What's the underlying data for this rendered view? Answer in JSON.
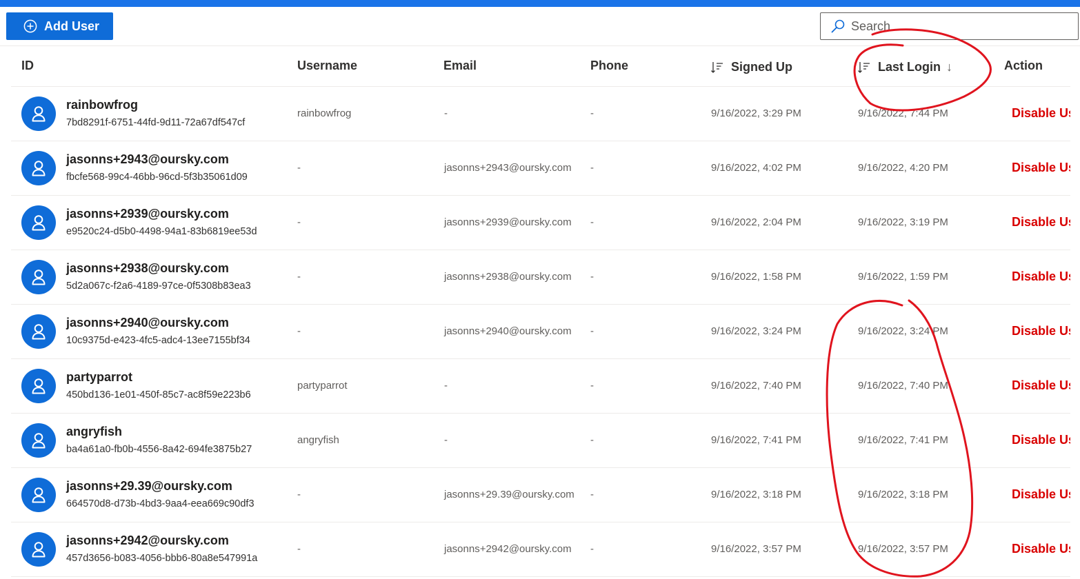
{
  "toolbar": {
    "add_user_label": "Add User",
    "search_placeholder": "Search"
  },
  "table": {
    "columns": {
      "id": "ID",
      "username": "Username",
      "email": "Email",
      "phone": "Phone",
      "signed_up": "Signed Up",
      "last_login": "Last Login",
      "last_login_sort_arrow": "↓",
      "action": "Action"
    },
    "rows": [
      {
        "name": "rainbowfrog",
        "id": "7bd8291f-6751-44fd-9d11-72a67df547cf",
        "username": "rainbowfrog",
        "email": "-",
        "phone": "-",
        "signed_up": "9/16/2022, 3:29 PM",
        "last_login": "9/16/2022, 7:44 PM",
        "action": "Disable User"
      },
      {
        "name": "jasonns+2943@oursky.com",
        "id": "fbcfe568-99c4-46bb-96cd-5f3b35061d09",
        "username": "-",
        "email": "jasonns+2943@oursky.com",
        "phone": "-",
        "signed_up": "9/16/2022, 4:02 PM",
        "last_login": "9/16/2022, 4:20 PM",
        "action": "Disable User"
      },
      {
        "name": "jasonns+2939@oursky.com",
        "id": "e9520c24-d5b0-4498-94a1-83b6819ee53d",
        "username": "-",
        "email": "jasonns+2939@oursky.com",
        "phone": "-",
        "signed_up": "9/16/2022, 2:04 PM",
        "last_login": "9/16/2022, 3:19 PM",
        "action": "Disable User"
      },
      {
        "name": "jasonns+2938@oursky.com",
        "id": "5d2a067c-f2a6-4189-97ce-0f5308b83ea3",
        "username": "-",
        "email": "jasonns+2938@oursky.com",
        "phone": "-",
        "signed_up": "9/16/2022, 1:58 PM",
        "last_login": "9/16/2022, 1:59 PM",
        "action": "Disable User"
      },
      {
        "name": "jasonns+2940@oursky.com",
        "id": "10c9375d-e423-4fc5-adc4-13ee7155bf34",
        "username": "-",
        "email": "jasonns+2940@oursky.com",
        "phone": "-",
        "signed_up": "9/16/2022, 3:24 PM",
        "last_login": "9/16/2022, 3:24 PM",
        "action": "Disable User"
      },
      {
        "name": "partyparrot",
        "id": "450bd136-1e01-450f-85c7-ac8f59e223b6",
        "username": "partyparrot",
        "email": "-",
        "phone": "-",
        "signed_up": "9/16/2022, 7:40 PM",
        "last_login": "9/16/2022, 7:40 PM",
        "action": "Disable User"
      },
      {
        "name": "angryfish",
        "id": "ba4a61a0-fb0b-4556-8a42-694fe3875b27",
        "username": "angryfish",
        "email": "-",
        "phone": "-",
        "signed_up": "9/16/2022, 7:41 PM",
        "last_login": "9/16/2022, 7:41 PM",
        "action": "Disable User"
      },
      {
        "name": "jasonns+29.39@oursky.com",
        "id": "664570d8-d73b-4bd3-9aa4-eea669c90df3",
        "username": "-",
        "email": "jasonns+29.39@oursky.com",
        "phone": "-",
        "signed_up": "9/16/2022, 3:18 PM",
        "last_login": "9/16/2022, 3:18 PM",
        "action": "Disable User"
      },
      {
        "name": "jasonns+2942@oursky.com",
        "id": "457d3656-b083-4056-bbb6-80a8e547991a",
        "username": "-",
        "email": "jasonns+2942@oursky.com",
        "phone": "-",
        "signed_up": "9/16/2022, 3:57 PM",
        "last_login": "9/16/2022, 3:57 PM",
        "action": "Disable User"
      }
    ]
  },
  "colors": {
    "accent": "#0f6cd8",
    "top_bar": "#1a73e8",
    "action_text": "#d90000",
    "annotation": "#e0141e"
  },
  "icons": {
    "add": "plus-circle-icon",
    "search": "search-icon",
    "sort": "sort-icon",
    "avatar": "person-icon"
  }
}
